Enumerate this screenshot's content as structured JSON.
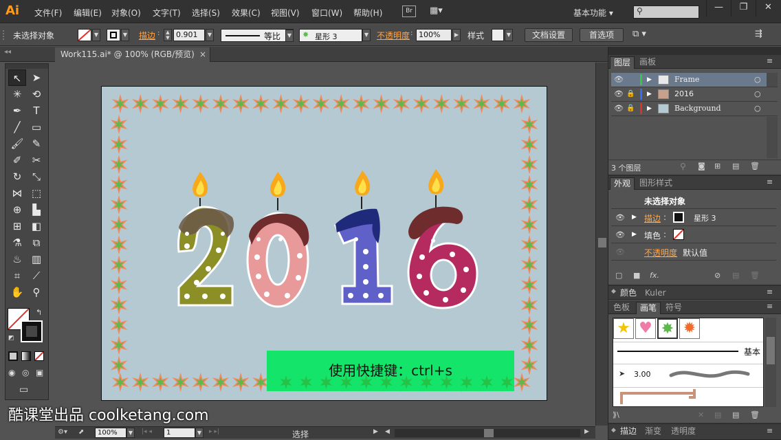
{
  "menubar": {
    "logo": "Ai",
    "items": [
      "文件(F)",
      "编辑(E)",
      "对象(O)",
      "文字(T)",
      "选择(S)",
      "效果(C)",
      "视图(V)",
      "窗口(W)",
      "帮助(H)"
    ],
    "bridge": "Br",
    "workspace": "基本功能",
    "search_placeholder": "",
    "win_buttons": [
      "—",
      "❐",
      "✕"
    ]
  },
  "control": {
    "selection": "未选择对象",
    "stroke_label": "描边",
    "stroke_value": "0.901",
    "profile": "等比",
    "brush": "星形 3",
    "opacity_label": "不透明度",
    "opacity_value": "100%",
    "style_label": "样式",
    "doc_setup": "文档设置",
    "preferences": "首选项"
  },
  "document": {
    "tab_title": "Work115.ai* @ 100% (RGB/预览)",
    "tab_close": "×",
    "shortcut_text": "使用快捷键：ctrl+s",
    "watermark": "酷课堂出品 coolketang.com",
    "year_digits": [
      "2",
      "0",
      "1",
      "6"
    ]
  },
  "status": {
    "zoom": "100%",
    "page": "1",
    "tool": "选择"
  },
  "layers": {
    "tabs": [
      "图层",
      "画板"
    ],
    "rows": [
      {
        "name": "Frame",
        "color": "#2ecc40",
        "selected": true
      },
      {
        "name": "2016",
        "color": "#2f6fff",
        "selected": false
      },
      {
        "name": "Background",
        "color": "#e0302c",
        "selected": false
      }
    ],
    "count": "3 个图层"
  },
  "appearance": {
    "tabs": [
      "外观",
      "图形样式"
    ],
    "title": "未选择对象",
    "stroke_label": "描边",
    "stroke_value": "星形 3",
    "fill_label": "填色",
    "opacity_label": "不透明度",
    "opacity_value": "默认值",
    "fx": "fx."
  },
  "color_panel": {
    "tabs": [
      "颜色",
      "Kuler"
    ]
  },
  "brushes": {
    "tabs": [
      "色板",
      "画笔",
      "符号"
    ],
    "basic": "基本",
    "size": "3.00"
  },
  "bottom_tabs": [
    "描边",
    "渐变",
    "透明度"
  ],
  "colors": {
    "accent": "#ff9a1b",
    "frame_star": "#5db84d",
    "artboard": "#b4c9d1",
    "shortcut_bg": "#14e56a"
  }
}
